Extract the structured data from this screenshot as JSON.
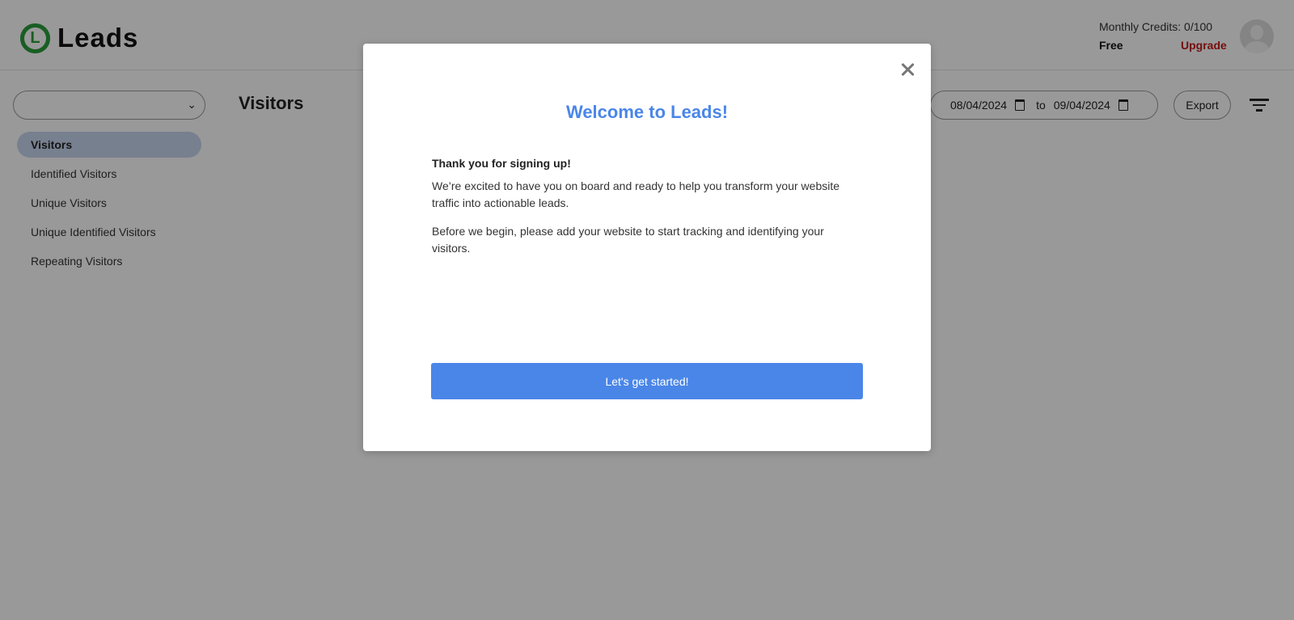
{
  "header": {
    "logo_letter": "L",
    "app_name": "Leads",
    "credits_text": "Monthly Credits: 0/100",
    "plan": "Free",
    "upgrade_label": "Upgrade"
  },
  "sidebar": {
    "site_select_value": "",
    "items": [
      {
        "label": "Visitors",
        "active": true
      },
      {
        "label": "Identified Visitors",
        "active": false
      },
      {
        "label": "Unique Visitors",
        "active": false
      },
      {
        "label": "Unique Identified Visitors",
        "active": false
      },
      {
        "label": "Repeating Visitors",
        "active": false
      }
    ]
  },
  "main": {
    "title": "Visitors",
    "date_from": "08/04/2024",
    "date_to_label": "to",
    "date_to": "09/04/2024",
    "export_label": "Export"
  },
  "modal": {
    "title": "Welcome to Leads!",
    "subtitle": "Thank you for signing up!",
    "paragraph1": "We’re excited to have you on board and ready to help you transform your website traffic into actionable leads.",
    "paragraph2": "Before we begin, please add your website to start tracking and identifying your visitors.",
    "button_label": "Let's get started!"
  },
  "colors": {
    "accent": "#4a86e8",
    "brand_green": "#2a9d3c",
    "upgrade_red": "#c41a1a",
    "active_nav": "#c7d6ee"
  },
  "icons": [
    "logo-icon",
    "chevron-down-icon",
    "calendar-icon",
    "filter-icon",
    "avatar-icon",
    "close-icon"
  ]
}
